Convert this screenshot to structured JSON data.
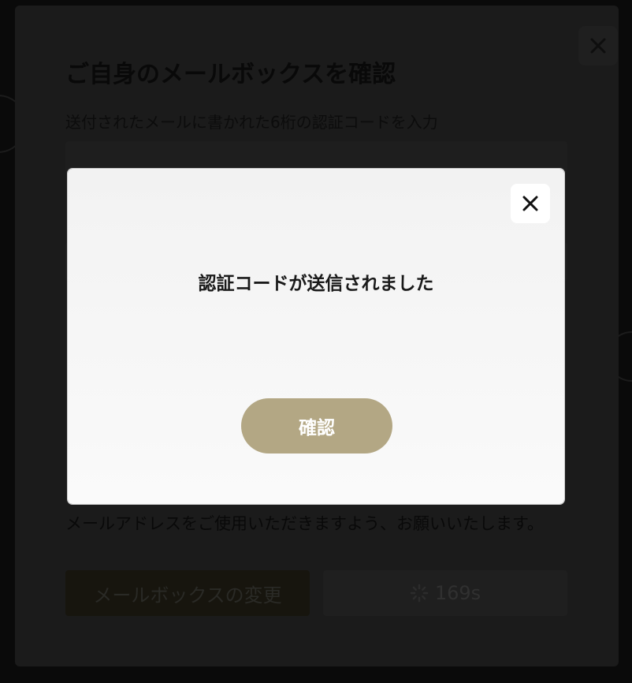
{
  "base_modal": {
    "title": "ご自身のメールボックスを確認",
    "subtitle": "送付されたメールに書かれた6桁の認証コードを入力",
    "note": "メールアドレスをご使用いただきますよう、お願いいたします。",
    "change_button": "メールボックスの変更",
    "timer_button": "169s",
    "close_icon": "close-icon",
    "spinner_icon": "spinner-icon"
  },
  "dialog": {
    "message": "認証コードが送信されました",
    "confirm_button": "確認",
    "close_icon": "close-icon"
  },
  "colors": {
    "confirm": "#b3a784",
    "dialog_bg": "#f6f6f6",
    "overlay_modal": "#1b1b1b"
  }
}
